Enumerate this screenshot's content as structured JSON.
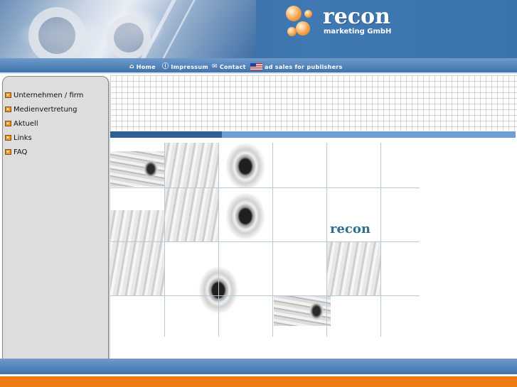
{
  "header": {
    "logo_text": "recon",
    "logo_subtitle": "marketing GmbH"
  },
  "nav": {
    "items": [
      {
        "label": "Home",
        "icon": "home-icon"
      },
      {
        "label": "Impressum",
        "icon": "info-icon"
      },
      {
        "label": "Contact",
        "icon": "envelope-icon"
      },
      {
        "label": "ad sales for publishers",
        "icon": "us-flag-icon"
      }
    ]
  },
  "sidebar": {
    "items": [
      {
        "label": "Unternehmen / firm"
      },
      {
        "label": "Medienvertretung"
      },
      {
        "label": "Aktuell"
      },
      {
        "label": "Links"
      },
      {
        "label": "FAQ"
      }
    ]
  },
  "main": {
    "mosaic_logo": "recon"
  },
  "colors": {
    "header_blue": "#3a6ea6",
    "nav_blue": "#4f84bd",
    "accent_orange": "#ee7a14",
    "sidebar_gray": "#dddddd",
    "logo_teal": "#2e6f8f"
  }
}
